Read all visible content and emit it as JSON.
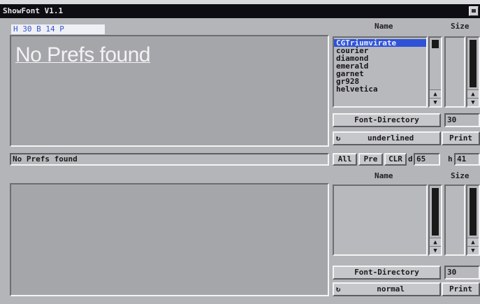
{
  "window": {
    "title": "ShowFont V1.1"
  },
  "status_top": "H 30 B 14 P",
  "preview_top": {
    "text": "No Prefs found"
  },
  "status_mid": "No Prefs found",
  "panel_top": {
    "name_header": "Name",
    "size_header": "Size",
    "fonts": [
      "CGTriumvirate",
      "courier",
      "diamond",
      "emerald",
      "garnet",
      "gr928",
      "helvetica"
    ],
    "selected_index": 0,
    "font_dir_label": "Font-Directory",
    "size_value": "30",
    "style_value": "underlined",
    "print_label": "Print"
  },
  "controls": {
    "all_label": "All",
    "pre_label": "Pre",
    "clr_label": "CLR",
    "d_label": "d",
    "d_value": "65",
    "h_label": "h",
    "h_value": "41"
  },
  "panel_bottom": {
    "name_header": "Name",
    "size_header": "Size",
    "font_dir_label": "Font-Directory",
    "size_value": "30",
    "style_value": "normal",
    "print_label": "Print"
  },
  "icons": {
    "cycle": "cycle-icon",
    "scroll_up": "arrow-up-icon",
    "scroll_down": "arrow-down-icon"
  }
}
